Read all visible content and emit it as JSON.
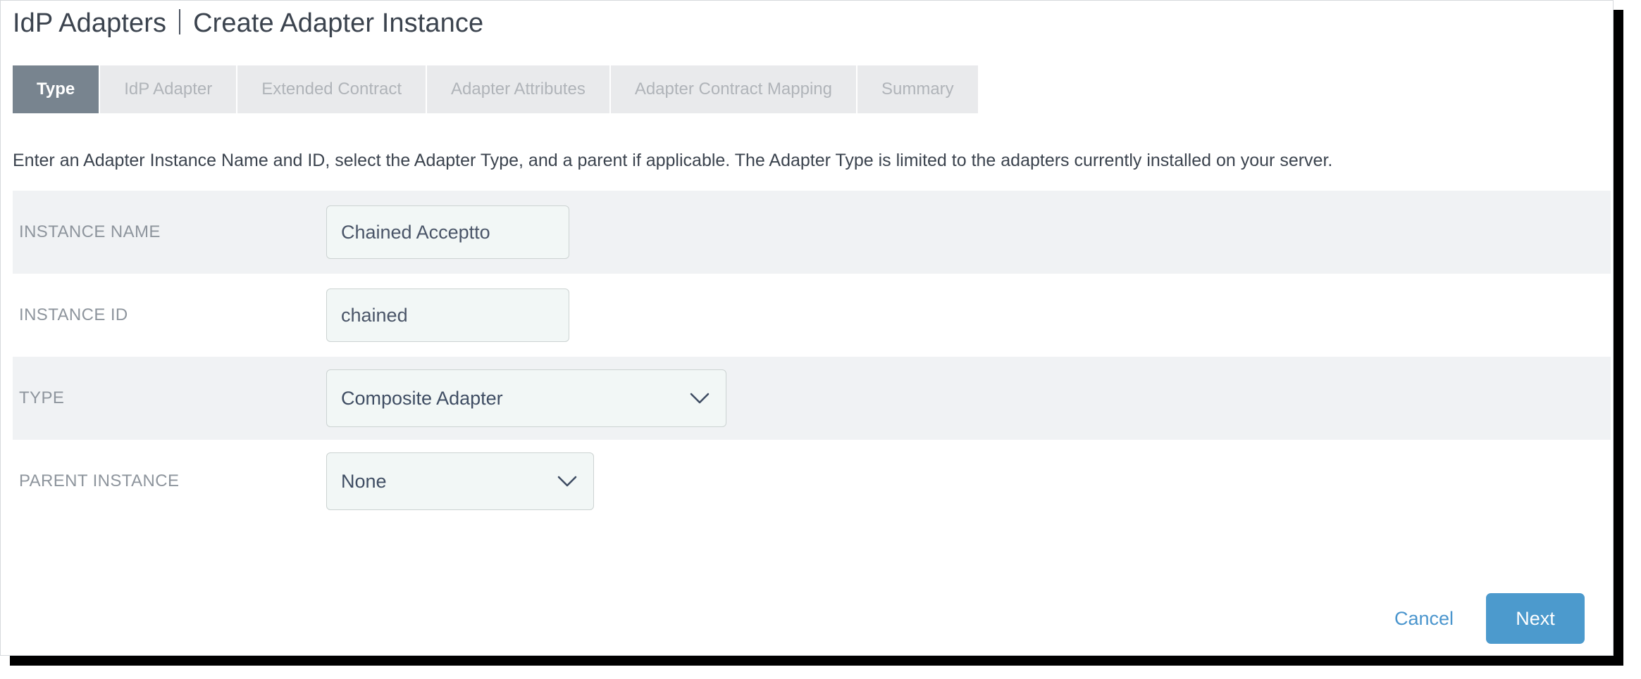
{
  "header": {
    "breadcrumb_root": "IdP Adapters",
    "breadcrumb_current": "Create Adapter Instance"
  },
  "tabs": [
    {
      "label": "Type",
      "active": true
    },
    {
      "label": "IdP Adapter",
      "active": false
    },
    {
      "label": "Extended Contract",
      "active": false
    },
    {
      "label": "Adapter Attributes",
      "active": false
    },
    {
      "label": "Adapter Contract Mapping",
      "active": false
    },
    {
      "label": "Summary",
      "active": false
    }
  ],
  "description": "Enter an Adapter Instance Name and ID, select the Adapter Type, and a parent if applicable. The Adapter Type is limited to the adapters currently installed on your server.",
  "fields": {
    "instance_name": {
      "label": "INSTANCE NAME",
      "value": "Chained Acceptto",
      "placeholder": ""
    },
    "instance_id": {
      "label": "INSTANCE ID",
      "value": "chained",
      "placeholder": ""
    },
    "type": {
      "label": "TYPE",
      "value": "Composite Adapter",
      "icon": "chevron-down-icon"
    },
    "parent_instance": {
      "label": "PARENT INSTANCE",
      "value": "None",
      "icon": "chevron-down-icon"
    }
  },
  "actions": {
    "cancel_label": "Cancel",
    "next_label": "Next"
  },
  "colors": {
    "active_tab_bg": "#78848f",
    "inactive_tab_bg": "#e9eaec",
    "primary_button_bg": "#4c9acd",
    "link_color": "#4a95cd",
    "shaded_row_bg": "#f0f2f4",
    "input_bg": "#f2f7f6",
    "text_color": "#3b434e",
    "label_color": "#8e959d"
  }
}
